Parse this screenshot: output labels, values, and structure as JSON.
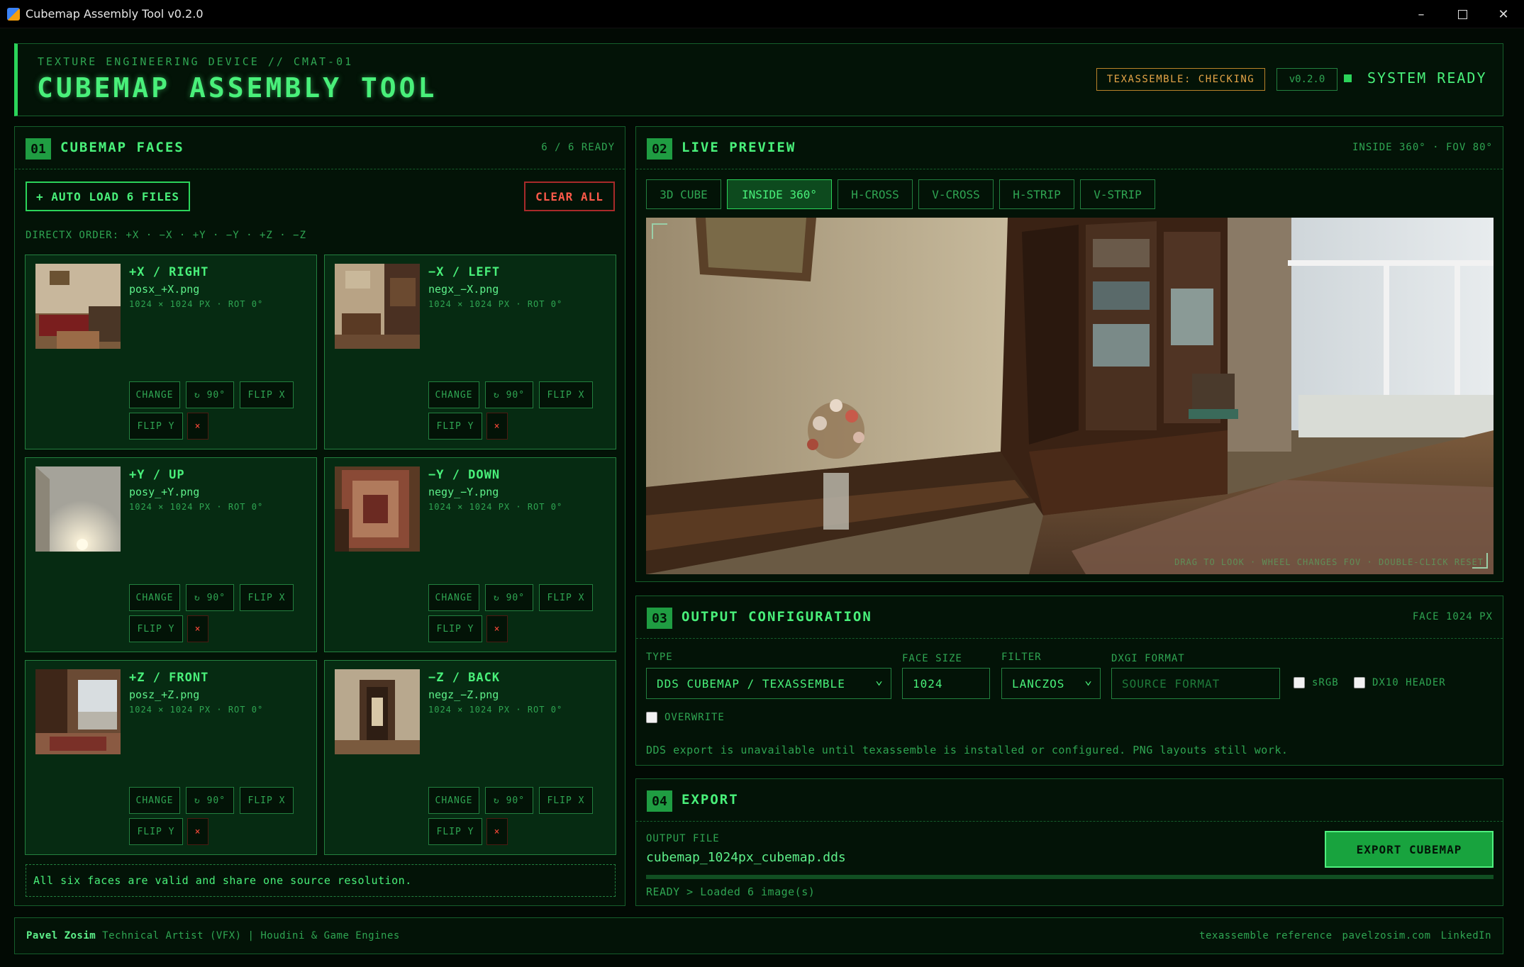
{
  "window": {
    "title": "Cubemap Assembly Tool v0.2.0",
    "controls": [
      "–",
      "□",
      "✕"
    ]
  },
  "header": {
    "subtitle": "TEXTURE ENGINEERING DEVICE // CMAT-01",
    "title": "CUBEMAP ASSEMBLY TOOL",
    "badge_texassemble": "TEXASSEMBLE: CHECKING",
    "badge_version": "v0.2.0",
    "system_status": "SYSTEM READY"
  },
  "faces_panel": {
    "num": "01",
    "title": "CUBEMAP FACES",
    "ready_count": "6 / 6 READY",
    "auto_load_label": "+ AUTO LOAD 6 FILES",
    "clear_all_label": "CLEAR ALL",
    "order_label": "DIRECTX ORDER: +X · −X · +Y · −Y · +Z · −Z",
    "buttons": {
      "change": "CHANGE",
      "rotate": "↻ 90°",
      "flip_x": "FLIP X",
      "flip_y": "FLIP Y",
      "remove": "×"
    },
    "faces": [
      {
        "name": "+X / RIGHT",
        "file": "posx_+X.png",
        "info": "1024 × 1024 PX · ROT 0°"
      },
      {
        "name": "−X / LEFT",
        "file": "negx_−X.png",
        "info": "1024 × 1024 PX · ROT 0°"
      },
      {
        "name": "+Y / UP",
        "file": "posy_+Y.png",
        "info": "1024 × 1024 PX · ROT 0°"
      },
      {
        "name": "−Y / DOWN",
        "file": "negy_−Y.png",
        "info": "1024 × 1024 PX · ROT 0°"
      },
      {
        "name": "+Z / FRONT",
        "file": "posz_+Z.png",
        "info": "1024 × 1024 PX · ROT 0°"
      },
      {
        "name": "−Z / BACK",
        "file": "negz_−Z.png",
        "info": "1024 × 1024 PX · ROT 0°"
      }
    ],
    "status": "All six faces are valid and share one source resolution."
  },
  "preview_panel": {
    "num": "02",
    "title": "LIVE PREVIEW",
    "info": "INSIDE 360° · FOV 80°",
    "modes": [
      "3D CUBE",
      "INSIDE 360°",
      "H-CROSS",
      "V-CROSS",
      "H-STRIP",
      "V-STRIP"
    ],
    "active_mode": "INSIDE 360°",
    "hint": "DRAG TO LOOK · WHEEL CHANGES FOV · DOUBLE-CLICK RESET"
  },
  "output_panel": {
    "num": "03",
    "title": "OUTPUT CONFIGURATION",
    "info": "FACE 1024 PX",
    "type_label": "TYPE",
    "type_value": "DDS CUBEMAP / TEXASSEMBLE",
    "face_size_label": "FACE SIZE",
    "face_size_value": "1024",
    "filter_label": "FILTER",
    "filter_value": "LANCZOS",
    "dxgi_label": "DXGI FORMAT",
    "dxgi_placeholder": "SOURCE FORMAT",
    "srgb_label": "sRGB",
    "dx10_label": "DX10 HEADER",
    "overwrite_label": "OVERWRITE",
    "note": "DDS export is unavailable until texassemble is installed or configured. PNG layouts still work."
  },
  "export_panel": {
    "num": "04",
    "title": "EXPORT",
    "output_label": "OUTPUT FILE",
    "output_file": "cubemap_1024px_cubemap.dds",
    "export_button": "EXPORT CUBEMAP",
    "status": "READY > Loaded 6 image(s)"
  },
  "footer": {
    "author": "Pavel Zosim",
    "role": "Technical Artist (VFX) | Houdini & Game Engines",
    "links": [
      "texassemble reference",
      "pavelzosim.com",
      "LinkedIn"
    ]
  },
  "colors": {
    "accent": "#3ee06a",
    "danger": "#ff5a4a",
    "warning": "#e4a447",
    "background": "#020a04"
  }
}
